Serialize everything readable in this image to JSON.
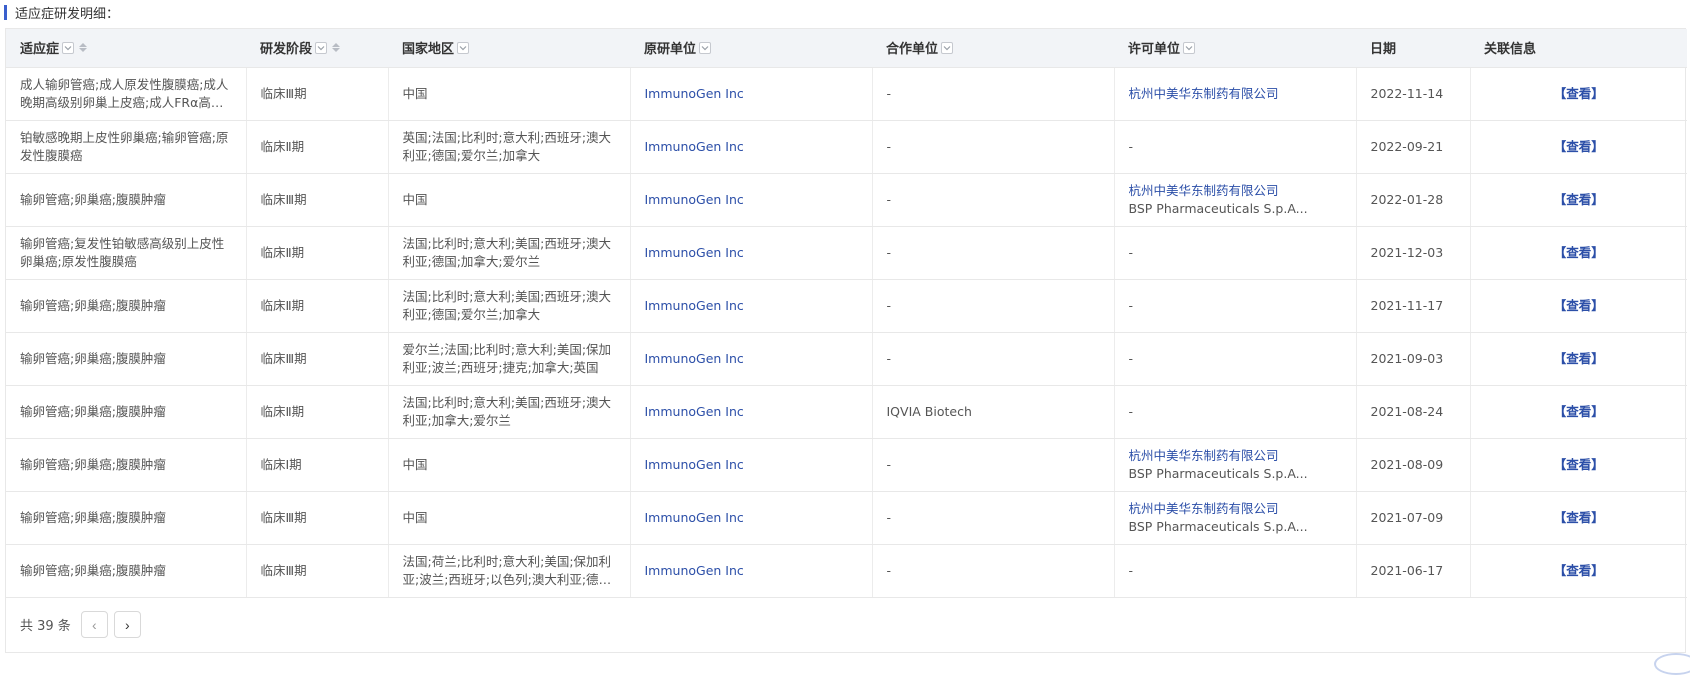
{
  "section_title": "适应症研发明细：",
  "columns": [
    {
      "label": "适应症",
      "filter": true,
      "sort": true
    },
    {
      "label": "研发阶段",
      "filter": true,
      "sort": true
    },
    {
      "label": "国家地区",
      "filter": true,
      "sort": false
    },
    {
      "label": "原研单位",
      "filter": true,
      "sort": false
    },
    {
      "label": "合作单位",
      "filter": true,
      "sort": false
    },
    {
      "label": "许可单位",
      "filter": true,
      "sort": false
    },
    {
      "label": "日期",
      "filter": false,
      "sort": false
    },
    {
      "label": "关联信息",
      "filter": false,
      "sort": false
    }
  ],
  "rows": [
    {
      "indication": "成人输卵管癌;成人原发性腹膜癌;成人晚期高级别卵巢上皮癌;成人FRα高表达...",
      "phase": "临床Ⅲ期",
      "region": "中国",
      "originator": "ImmunoGen Inc",
      "partner": "-",
      "licensee": [
        "杭州中美华东制药有限公司"
      ],
      "date": "2022-11-14",
      "action": "【查看】"
    },
    {
      "indication": "铂敏感晚期上皮性卵巢癌;输卵管癌;原发性腹膜癌",
      "phase": "临床Ⅱ期",
      "region": "英国;法国;比利时;意大利;西班牙;澳大利亚;德国;爱尔兰;加拿大",
      "originator": "ImmunoGen Inc",
      "partner": "-",
      "licensee": [
        "-"
      ],
      "date": "2022-09-21",
      "action": "【查看】"
    },
    {
      "indication": "输卵管癌;卵巢癌;腹膜肿瘤",
      "phase": "临床Ⅲ期",
      "region": "中国",
      "originator": "ImmunoGen Inc",
      "partner": "-",
      "licensee": [
        "杭州中美华东制药有限公司",
        "BSP Pharmaceuticals S.p.A..."
      ],
      "date": "2022-01-28",
      "action": "【查看】"
    },
    {
      "indication": "输卵管癌;复发性铂敏感高级别上皮性卵巢癌;原发性腹膜癌",
      "phase": "临床Ⅱ期",
      "region": "法国;比利时;意大利;美国;西班牙;澳大利亚;德国;加拿大;爱尔兰",
      "originator": "ImmunoGen Inc",
      "partner": "-",
      "licensee": [
        "-"
      ],
      "date": "2021-12-03",
      "action": "【查看】"
    },
    {
      "indication": "输卵管癌;卵巢癌;腹膜肿瘤",
      "phase": "临床Ⅱ期",
      "region": "法国;比利时;意大利;美国;西班牙;澳大利亚;德国;爱尔兰;加拿大",
      "originator": "ImmunoGen Inc",
      "partner": "-",
      "licensee": [
        "-"
      ],
      "date": "2021-11-17",
      "action": "【查看】"
    },
    {
      "indication": "输卵管癌;卵巢癌;腹膜肿瘤",
      "phase": "临床Ⅲ期",
      "region": "爱尔兰;法国;比利时;意大利;美国;保加利亚;波兰;西班牙;捷克;加拿大;英国",
      "originator": "ImmunoGen Inc",
      "partner": "-",
      "licensee": [
        "-"
      ],
      "date": "2021-09-03",
      "action": "【查看】"
    },
    {
      "indication": "输卵管癌;卵巢癌;腹膜肿瘤",
      "phase": "临床Ⅱ期",
      "region": "法国;比利时;意大利;美国;西班牙;澳大利亚;加拿大;爱尔兰",
      "originator": "ImmunoGen Inc",
      "partner": "IQVIA Biotech",
      "licensee": [
        "-"
      ],
      "date": "2021-08-24",
      "action": "【查看】"
    },
    {
      "indication": "输卵管癌;卵巢癌;腹膜肿瘤",
      "phase": "临床Ⅰ期",
      "region": "中国",
      "originator": "ImmunoGen Inc",
      "partner": "-",
      "licensee": [
        "杭州中美华东制药有限公司",
        "BSP Pharmaceuticals S.p.A..."
      ],
      "date": "2021-08-09",
      "action": "【查看】"
    },
    {
      "indication": "输卵管癌;卵巢癌;腹膜肿瘤",
      "phase": "临床Ⅲ期",
      "region": "中国",
      "originator": "ImmunoGen Inc",
      "partner": "-",
      "licensee": [
        "杭州中美华东制药有限公司",
        "BSP Pharmaceuticals S.p.A..."
      ],
      "date": "2021-07-09",
      "action": "【查看】"
    },
    {
      "indication": "输卵管癌;卵巢癌;腹膜肿瘤",
      "phase": "临床Ⅲ期",
      "region": "法国;荷兰;比利时;意大利;美国;保加利亚;波兰;西班牙;以色列;澳大利亚;德国;爱...",
      "originator": "ImmunoGen Inc",
      "partner": "-",
      "licensee": [
        "-"
      ],
      "date": "2021-06-17",
      "action": "【查看】"
    }
  ],
  "pagination": {
    "total_text": "共 39 条",
    "prev": "‹",
    "next": "›"
  },
  "colors": {
    "accent": "#3a5fcd",
    "link": "#2c4fa8",
    "header_bg": "#f2f4f7"
  }
}
